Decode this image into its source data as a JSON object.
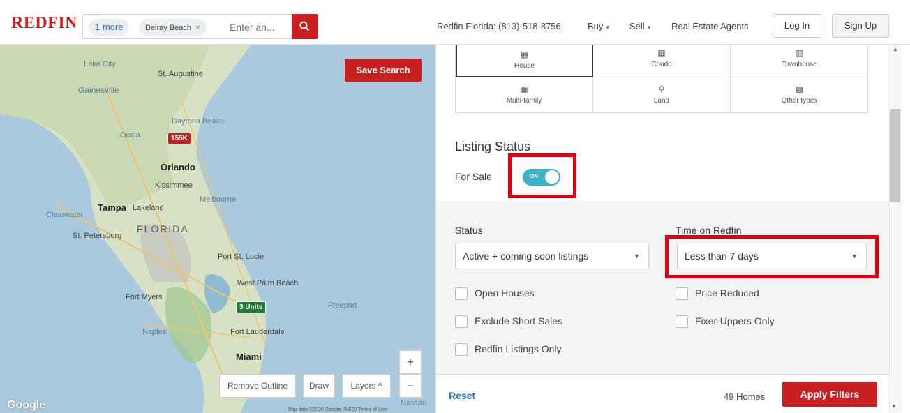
{
  "header": {
    "logo": "REDFIN",
    "chip_more": "1 more",
    "chip_city": "Delray Beach",
    "chip_remove": "×",
    "search_placeholder": "Enter an...",
    "phone": "Redfin Florida: (813)-518-8756",
    "nav_buy": "Buy",
    "nav_sell": "Sell",
    "nav_agents": "Real Estate Agents",
    "login": "Log In",
    "signup": "Sign Up",
    "caret": "▾"
  },
  "map": {
    "save_search": "Save Search",
    "cities": {
      "lake_city": "Lake City",
      "st_augustine": "St. Augustine",
      "gainesville": "Gainesville",
      "daytona": "Daytona Beach",
      "ocala": "Ocala",
      "orlando": "Orlando",
      "kissimmee": "Kissimmee",
      "melbourne": "Melbourne",
      "clearwater": "Clearwater",
      "tampa": "Tampa",
      "lakeland": "Lakeland",
      "st_petersburg": "St. Petersburg",
      "florida": "FLORIDA",
      "port_st_lucie": "Port St. Lucie",
      "west_palm": "West Palm Beach",
      "fort_myers": "Fort Myers",
      "freeport": "Freeport",
      "naples": "Naples",
      "fort_lauderdale": "Fort Lauderdale",
      "miami": "Miami",
      "nassau": "Nassau"
    },
    "price_pin": "155K",
    "units_pin": "3 Units",
    "remove_outline": "Remove Outline",
    "draw": "Draw",
    "layers": "Layers ^",
    "zoom_in": "+",
    "zoom_out": "−",
    "google": "Google",
    "attribution": "Map data ©2020 Google, INEGI   Terms of Use"
  },
  "filters": {
    "property_types": [
      {
        "label": "House",
        "icon": "house-icon",
        "glyph": "▦"
      },
      {
        "label": "Condo",
        "icon": "condo-icon",
        "glyph": "▦"
      },
      {
        "label": "Townhouse",
        "icon": "townhouse-icon",
        "glyph": "▥"
      },
      {
        "label": "Multi-family",
        "icon": "multi-family-icon",
        "glyph": "▦"
      },
      {
        "label": "Land",
        "icon": "land-icon",
        "glyph": "⚲"
      },
      {
        "label": "Other types",
        "icon": "other-types-icon",
        "glyph": "▩"
      }
    ],
    "listing_status_title": "Listing Status",
    "for_sale_label": "For Sale",
    "toggle_text": "ON",
    "status_label": "Status",
    "status_value": "Active + coming soon listings",
    "time_label": "Time on Redfin",
    "time_value": "Less than 7 days",
    "select_arrow": "▼",
    "checkboxes": {
      "open_houses": "Open Houses",
      "price_reduced": "Price Reduced",
      "exclude_short_sales": "Exclude Short Sales",
      "fixer_uppers": "Fixer-Uppers Only",
      "redfin_only": "Redfin Listings Only"
    },
    "reset": "Reset",
    "count": "49 Homes",
    "apply": "Apply Filters"
  },
  "colors": {
    "brand_red": "#c82021",
    "toggle_teal": "#3bb3c6",
    "highlight_red": "#e0000f",
    "link_blue": "#2a6ebb"
  },
  "scrollbar": {
    "up": "▲",
    "down": "▼"
  }
}
